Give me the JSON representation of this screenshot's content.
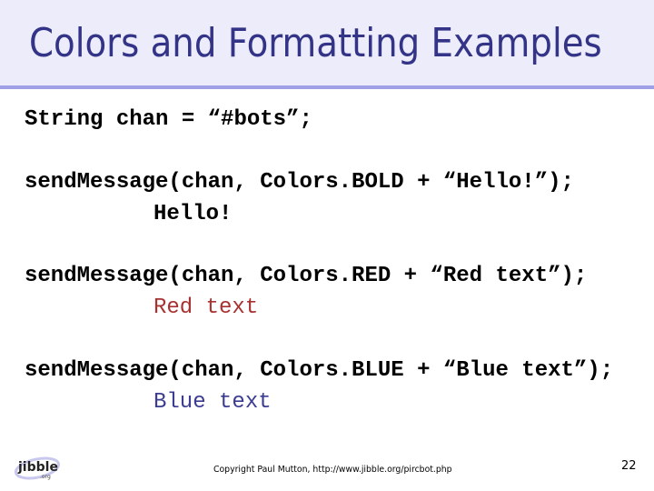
{
  "slide": {
    "title": "Colors and Formatting Examples",
    "colors": {
      "title": "#333388",
      "header_background": "#ececfb",
      "header_rule": "#a0a0e6",
      "red_output": "#a83232",
      "blue_output": "#3c3c92"
    },
    "body": {
      "line_declaration": "String chan = “#bots”;",
      "examples": [
        {
          "code": "sendMessage(chan, Colors.BOLD + “Hello!”);",
          "output": "Hello!",
          "style": "bold"
        },
        {
          "code": "sendMessage(chan, Colors.RED + “Red text”);",
          "output": "Red text",
          "style": "red"
        },
        {
          "code": "sendMessage(chan, Colors.BLUE + “Blue text”);",
          "output": "Blue text",
          "style": "blue"
        }
      ]
    },
    "footer": {
      "logo_text": "jibble",
      "logo_subtext": ".org",
      "logo_icon": "jibble-logo-icon",
      "copyright": "Copyright Paul Mutton, http://www.jibble.org/pircbot.php",
      "page_number": "22"
    }
  }
}
